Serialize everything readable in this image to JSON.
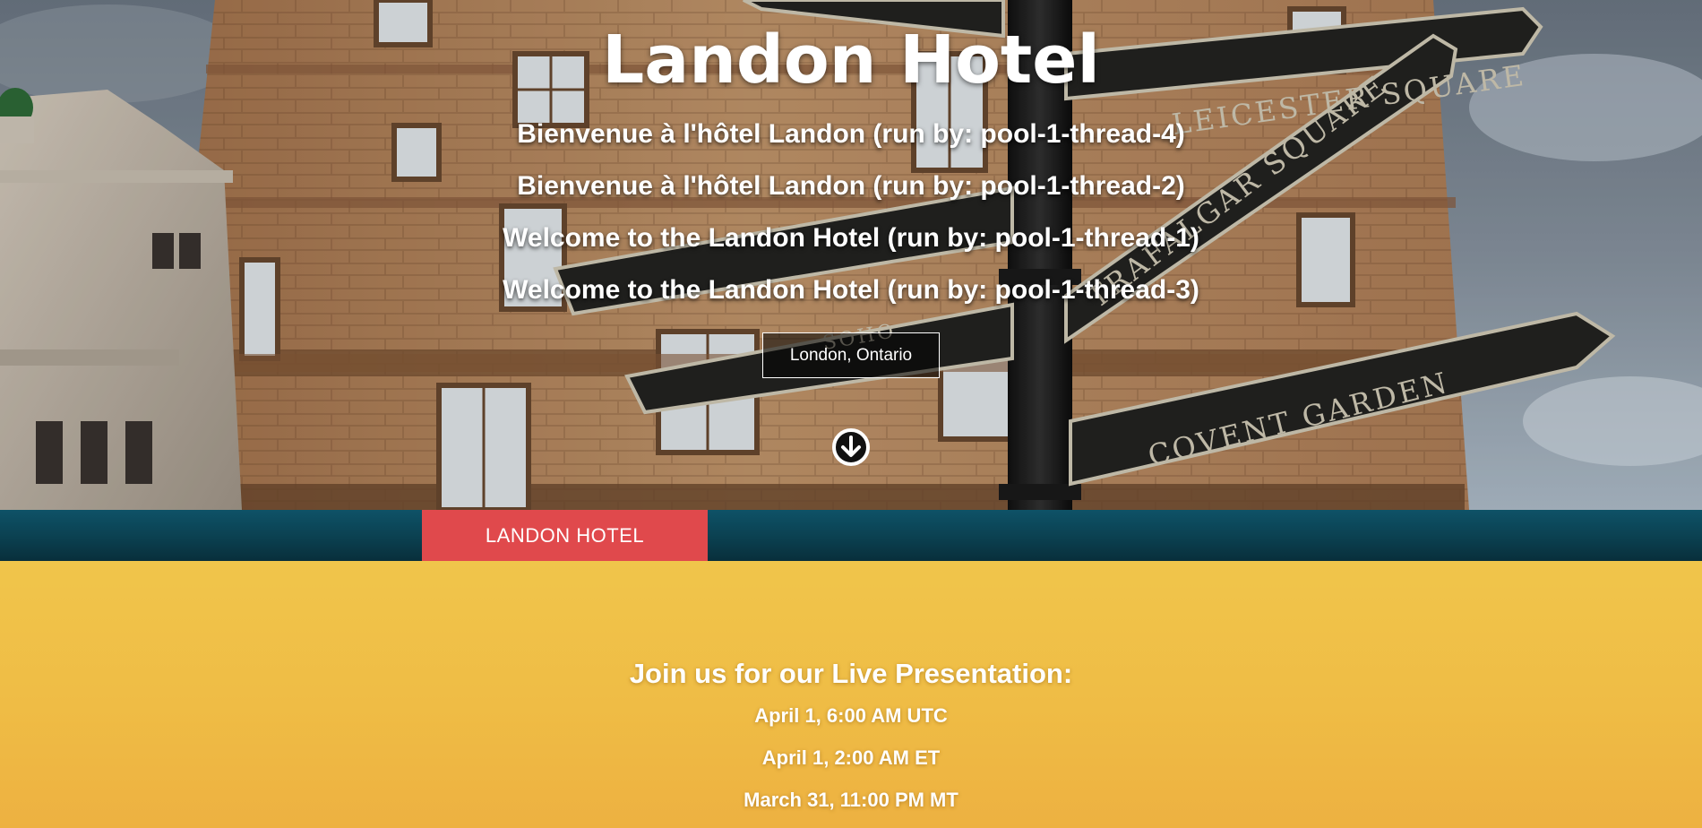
{
  "hero": {
    "title": "Landon Hotel",
    "welcome_messages": [
      "Bienvenue à l'hôtel Landon (run by: pool-1-thread-4)",
      "Bienvenue à l'hôtel Landon (run by: pool-1-thread-2)",
      "Welcome to the Landon Hotel (run by: pool-1-thread-1)",
      "Welcome to the Landon Hotel (run by: pool-1-thread-3)"
    ],
    "location": "London, Ontario",
    "scroll_icon": "arrow-down-circle-icon",
    "sign_labels": [
      "LEICESTER SQUARE",
      "TRAFALGAR SQUARE",
      "COVENT GARDEN",
      "SOHO"
    ]
  },
  "nav": {
    "brand": "LANDON HOTEL"
  },
  "presentation": {
    "heading": "Join us for our Live Presentation:",
    "times": [
      "April 1, 6:00 AM UTC",
      "April 1, 2:00 AM ET",
      "March 31, 11:00 PM MT"
    ]
  },
  "colors": {
    "nav_bar": "#0b4050",
    "brand_tab": "#e0494c",
    "presentation_bg": "#efbc45",
    "text": "#ffffff"
  }
}
